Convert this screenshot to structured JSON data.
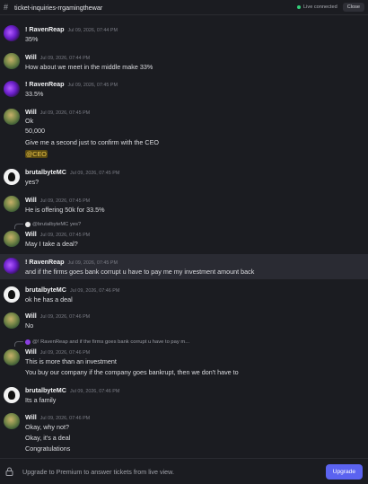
{
  "header": {
    "channel_name": "ticket-inquiries-rrgamingthewar",
    "status_text": "Live connected",
    "close_label": "Close"
  },
  "messages": [
    {
      "author": "! RavenReap",
      "time": "Jul 09, 2026, 07:44 PM",
      "lines": [
        "35%"
      ]
    },
    {
      "author": "Will",
      "time": "Jul 09, 2026, 07:44 PM",
      "lines": [
        "How about we meet in the middle make 33%"
      ]
    },
    {
      "author": "! RavenReap",
      "time": "Jul 09, 2026, 07:45 PM",
      "lines": [
        "33.5%"
      ]
    },
    {
      "author": "Will",
      "time": "Jul 09, 2026, 07:45 PM",
      "lines": [
        "Ok",
        "50,000",
        "Give me a second just to confirm with the CEO",
        "@CEO"
      ]
    },
    {
      "author": "brutalbyteMC",
      "time": "Jul 09, 2026, 07:45 PM",
      "lines": [
        "yes?"
      ]
    },
    {
      "author": "Will",
      "time": "Jul 09, 2026, 07:45 PM",
      "lines": [
        "He is offering 50k for 33.5%"
      ]
    },
    {
      "reply_to": "@brutalbyteMC yes?",
      "author": "Will",
      "time": "Jul 09, 2026, 07:45 PM",
      "lines": [
        "May I take a deal?"
      ]
    },
    {
      "author": "! RavenReap",
      "time": "Jul 09, 2026, 07:45 PM",
      "lines": [
        "and if the firms goes bank corrupt u have to pay me my investment amount back"
      ]
    },
    {
      "author": "brutalbyteMC",
      "time": "Jul 09, 2026, 07:46 PM",
      "lines": [
        "ok he has a deal"
      ]
    },
    {
      "author": "Will",
      "time": "Jul 09, 2026, 07:46 PM",
      "lines": [
        "No"
      ]
    },
    {
      "reply_to": "@! RavenReap and if the firms goes bank corrupt u have to pay m...",
      "author": "Will",
      "time": "Jul 09, 2026, 07:46 PM",
      "lines": [
        "This is more than an investment",
        "You buy our company if the company goes bankrupt, then we don't have to"
      ]
    },
    {
      "author": "brutalbyteMC",
      "time": "Jul 09, 2026, 07:46 PM",
      "lines": [
        "Its a family"
      ]
    },
    {
      "author": "Will",
      "time": "Jul 09, 2026, 07:46 PM",
      "lines": [
        "Okay, why not?",
        "Okay, it's a deal",
        "Congratulations"
      ]
    }
  ],
  "footer": {
    "notice": "Upgrade to Premium to answer tickets from live view.",
    "upgrade_label": "Upgrade"
  }
}
